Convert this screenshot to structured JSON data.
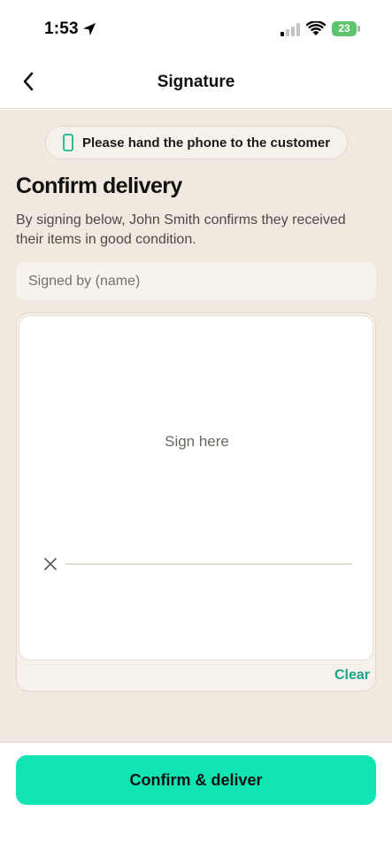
{
  "status_bar": {
    "time": "1:53",
    "battery_level": "23",
    "battery_color": "#5cc66e",
    "icons": [
      "location-arrow-icon",
      "cellular-signal-icon",
      "wifi-icon",
      "battery-icon"
    ]
  },
  "nav": {
    "title": "Signature",
    "back_icon": "chevron-left-icon"
  },
  "banner": {
    "icon": "phone-icon",
    "text": "Please hand the phone to the customer"
  },
  "main": {
    "heading": "Confirm delivery",
    "description": "By signing below, John Smith confirms they received their items in good condition."
  },
  "name_field": {
    "value": "",
    "placeholder": "Signed by (name)"
  },
  "signature_pad": {
    "prompt": "Sign here",
    "mark_icon": "x-icon",
    "clear_label": "Clear"
  },
  "footer": {
    "confirm_label": "Confirm & deliver"
  },
  "colors": {
    "accent": "#10e4b3",
    "link": "#1aa58a",
    "content_background": "#f1e8df"
  }
}
